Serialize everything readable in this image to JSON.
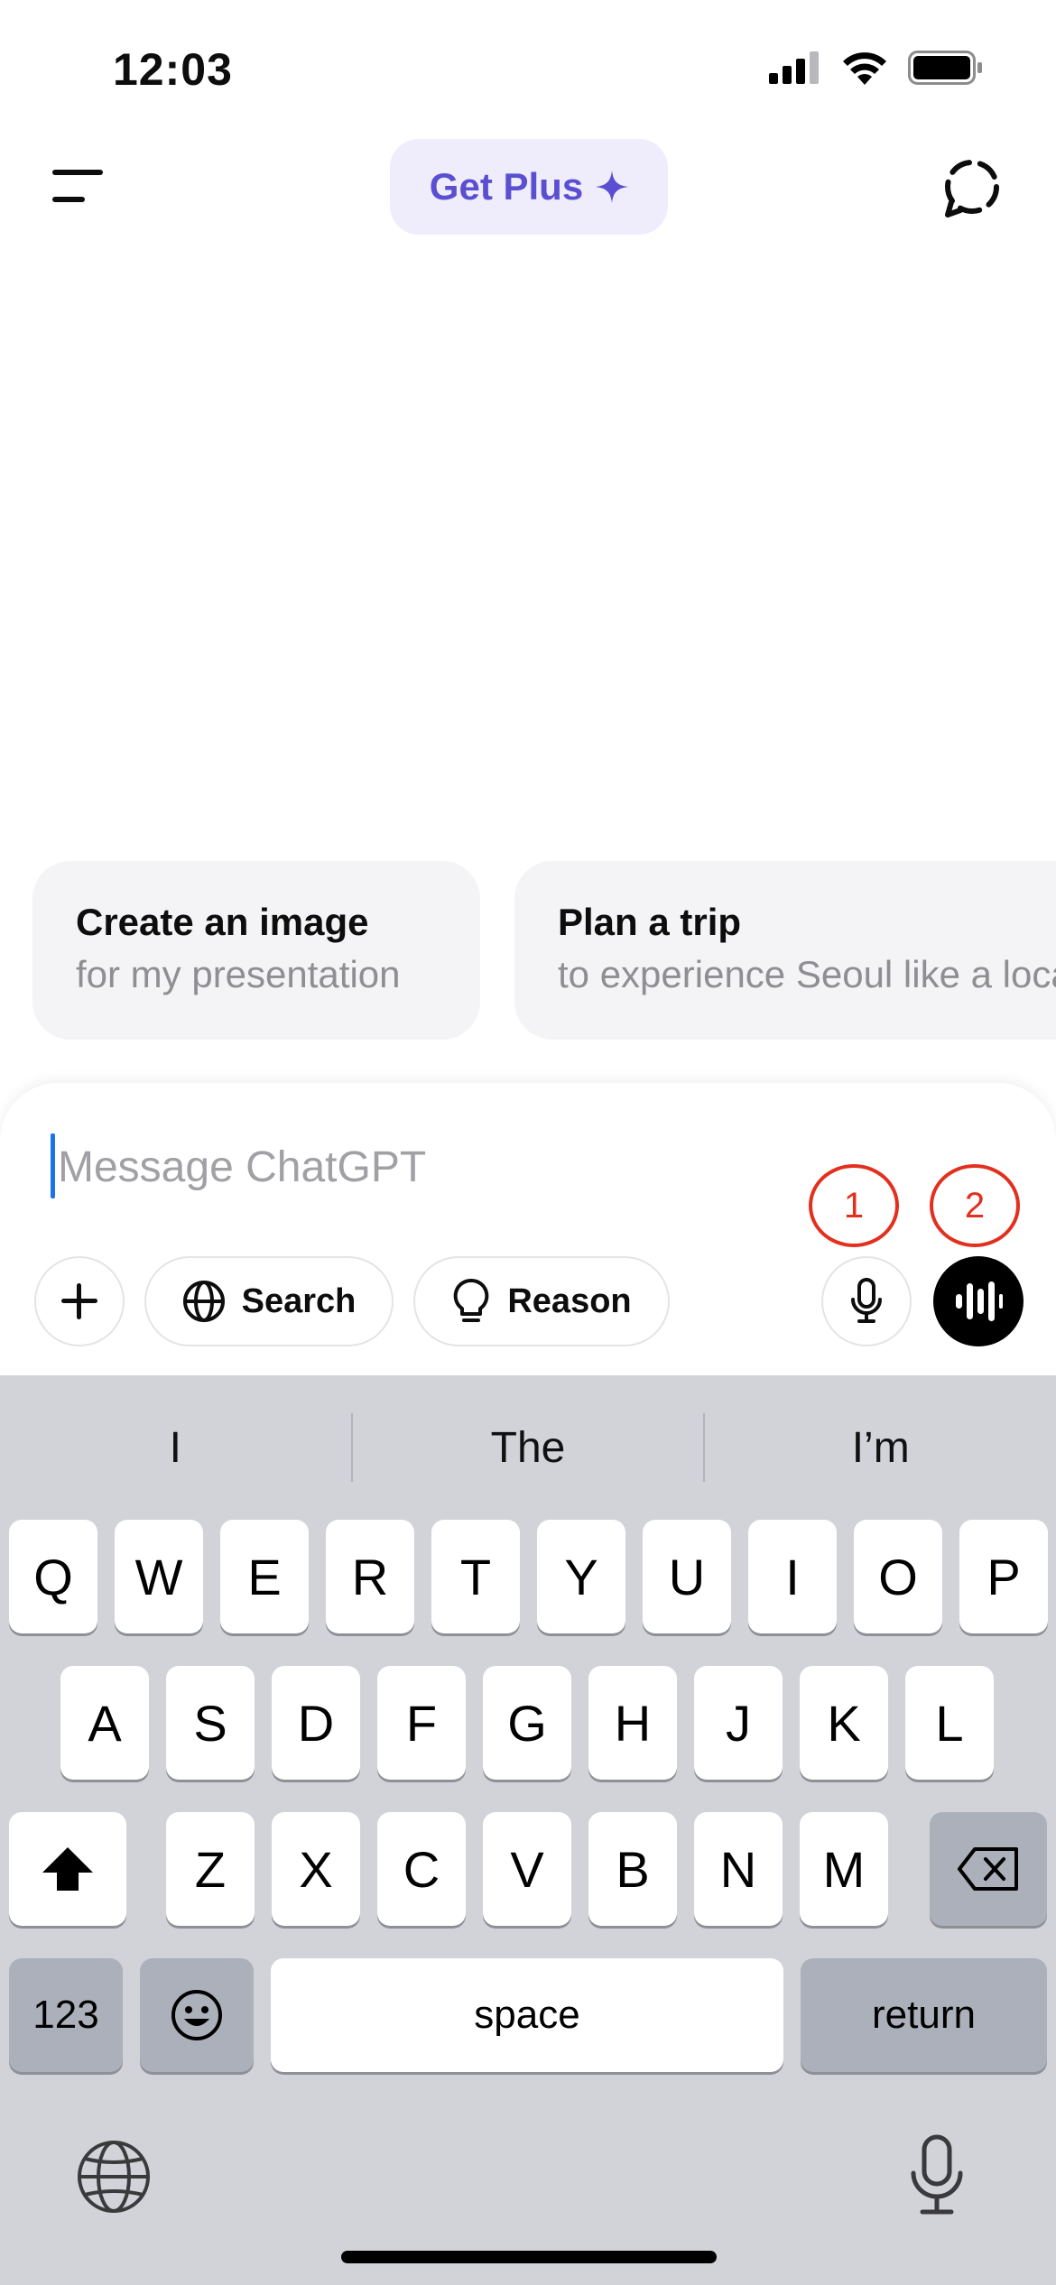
{
  "status_bar": {
    "time": "12:03",
    "icons": [
      "cellular-signal-icon",
      "wifi-icon",
      "battery-icon"
    ]
  },
  "header": {
    "menu_icon": "menu-icon",
    "get_plus_label": "Get Plus",
    "get_plus_icon": "sparkle-icon",
    "new_chat_icon": "dashed-circle-icon"
  },
  "suggestions": [
    {
      "title": "Create an image",
      "subtitle": "for my presentation"
    },
    {
      "title": "Plan a trip",
      "subtitle": "to experience Seoul like a local"
    }
  ],
  "composer": {
    "placeholder": "Message ChatGPT",
    "search_label": "Search",
    "reason_label": "Reason",
    "markers": [
      "1",
      "2"
    ]
  },
  "keyboard": {
    "predictions": [
      "I",
      "The",
      "I’m"
    ],
    "row1": [
      "Q",
      "W",
      "E",
      "R",
      "T",
      "Y",
      "U",
      "I",
      "O",
      "P"
    ],
    "row2": [
      "A",
      "S",
      "D",
      "F",
      "G",
      "H",
      "J",
      "K",
      "L"
    ],
    "row3": [
      "Z",
      "X",
      "C",
      "V",
      "B",
      "N",
      "M"
    ],
    "numbers_label": "123",
    "space_label": "space",
    "return_label": "return"
  },
  "colors": {
    "accent": "#5b4fd1",
    "marker": "#e3301e",
    "keyboard_bg": "#d1d3d9"
  }
}
